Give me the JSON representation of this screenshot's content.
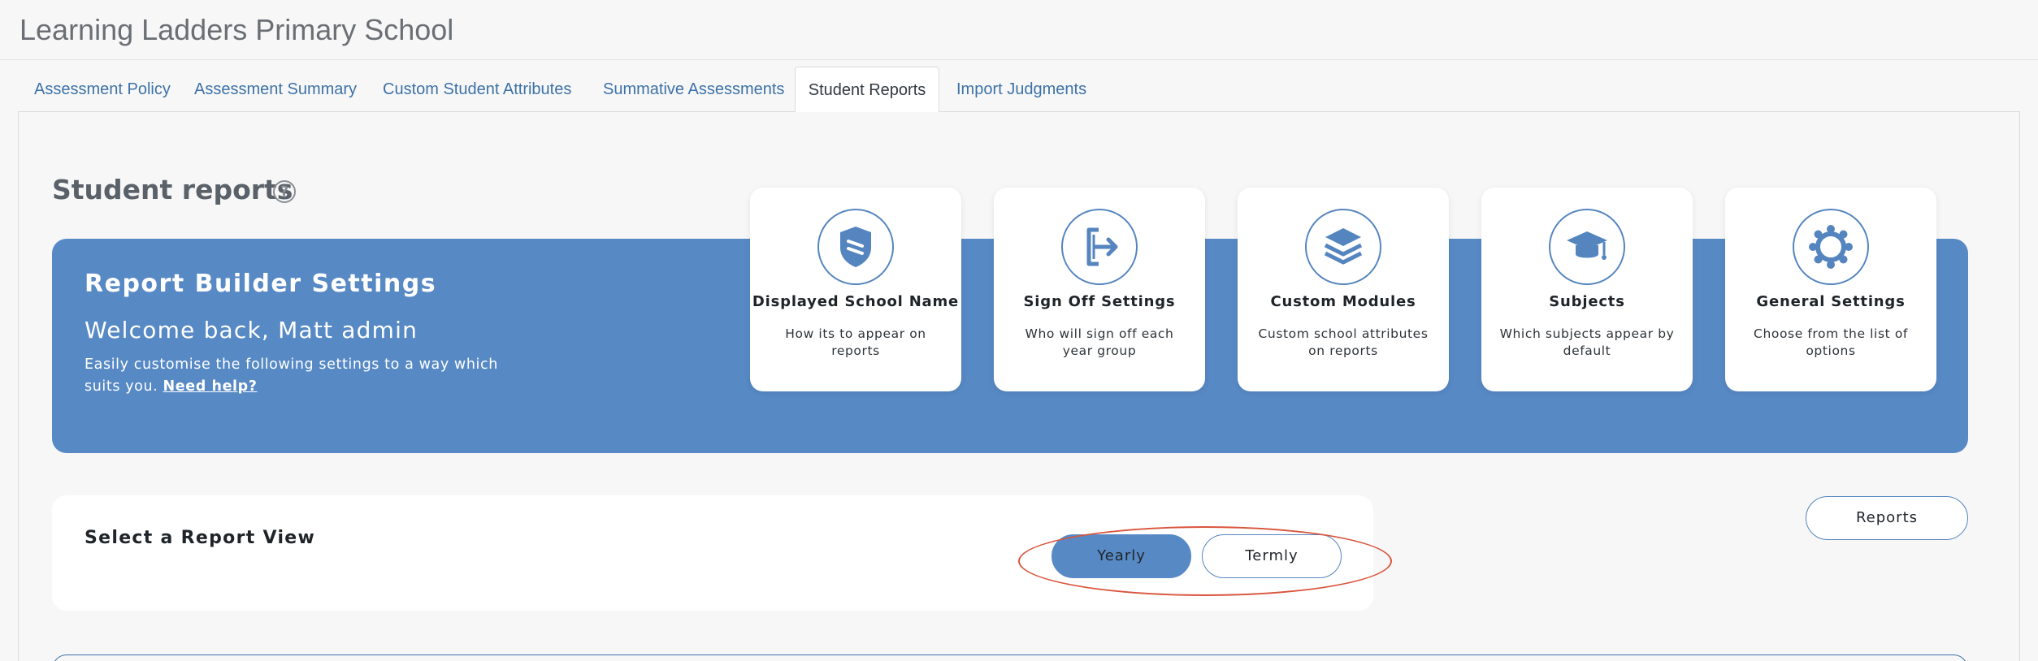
{
  "app": {
    "school_name": "Learning Ladders Primary School"
  },
  "tabs": [
    {
      "label": "Assessment Policy"
    },
    {
      "label": "Assessment Summary"
    },
    {
      "label": "Custom Student Attributes"
    },
    {
      "label": "Summative Assessments"
    },
    {
      "label": "Student Reports",
      "active": true
    },
    {
      "label": "Import Judgments"
    }
  ],
  "page": {
    "title": "Student reports",
    "help_icon": "?"
  },
  "banner": {
    "title": "Report Builder Settings",
    "welcome": "Welcome back, Matt admin",
    "description": "Easily customise the following settings to a way which suits you.",
    "help_link": "Need help?",
    "background_color": "#5789c5"
  },
  "cards": [
    {
      "icon": "shield-icon",
      "title": "Displayed School Name",
      "description": "How its to appear on reports"
    },
    {
      "icon": "sign-off-icon",
      "title": "Sign Off Settings",
      "description": "Who will sign off each year group"
    },
    {
      "icon": "layers-icon",
      "title": "Custom Modules",
      "description": "Custom school attributes on reports"
    },
    {
      "icon": "graduation-cap-icon",
      "title": "Subjects",
      "description": "Which subjects appear by default"
    },
    {
      "icon": "gear-icon",
      "title": "General Settings",
      "description": "Choose from the list of options"
    }
  ],
  "report_view": {
    "label": "Select a Report View",
    "options": [
      {
        "label": "Yearly",
        "selected": true
      },
      {
        "label": "Termly",
        "selected": false
      }
    ],
    "reports_button": "Reports"
  },
  "colors": {
    "accent": "#5789c5",
    "link": "#3d72a8",
    "highlight": "#d9553d"
  }
}
